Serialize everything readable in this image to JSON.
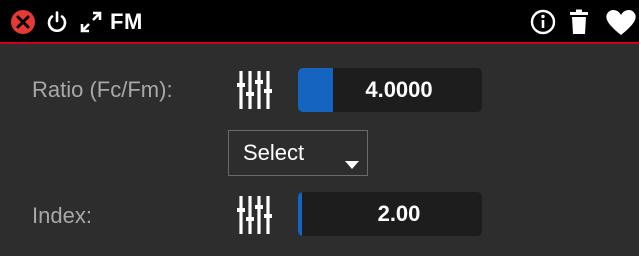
{
  "titlebar": {
    "title": "FM",
    "accent_color": "#d0021b",
    "icons": [
      "close-icon",
      "power-icon",
      "expand-icon",
      "info-icon",
      "trash-icon",
      "heart-icon"
    ]
  },
  "ratio": {
    "label": "Ratio (Fc/Fm):",
    "value": "4.0000",
    "fill_fraction": 0.19,
    "icon": "sliders-icon"
  },
  "select": {
    "label": "Select",
    "icon": "caret-down-icon"
  },
  "index": {
    "label": "Index:",
    "value": "2.00",
    "fill_fraction": 0.02,
    "icon": "sliders-icon"
  },
  "colors": {
    "background": "#2d2d2d",
    "fill": "#1565c0",
    "text": "#ffffff",
    "label": "#a8a8a8"
  }
}
